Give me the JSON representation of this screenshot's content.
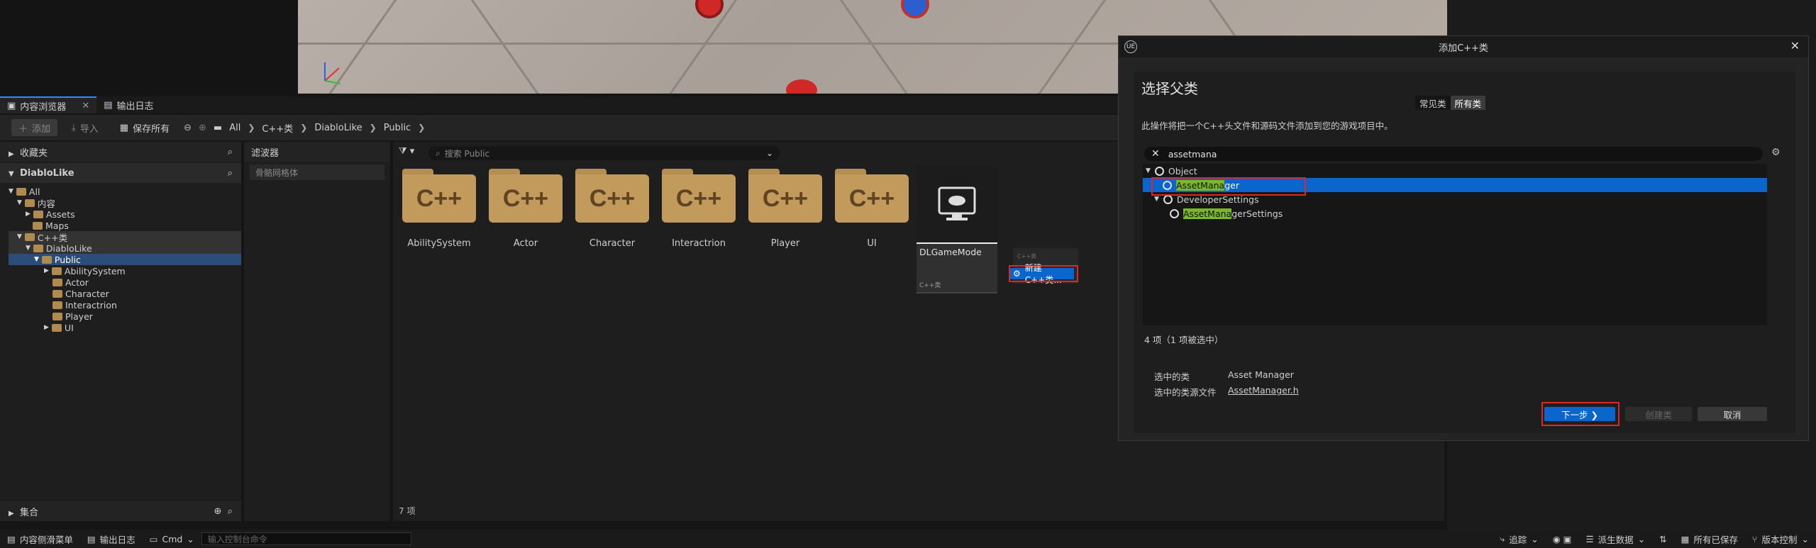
{
  "tabs": {
    "content_browser": "内容浏览器",
    "output_log": "输出日志"
  },
  "toolbar": {
    "add": "添加",
    "import": "导入",
    "save_all": "保存所有",
    "breadcrumbs": [
      "All",
      "C++类",
      "DiabloLike",
      "Public"
    ]
  },
  "sidebar": {
    "favorites": "收藏夹",
    "project": "DiabloLike",
    "tree": [
      {
        "label": "All",
        "indent": 0
      },
      {
        "label": "内容",
        "indent": 1
      },
      {
        "label": "Assets",
        "indent": 2
      },
      {
        "label": "Maps",
        "indent": 2
      },
      {
        "label": "C++类",
        "indent": 1
      },
      {
        "label": "DiabloLike",
        "indent": 2
      },
      {
        "label": "Public",
        "indent": 3
      },
      {
        "label": "AbilitySystem",
        "indent": 4
      },
      {
        "label": "Actor",
        "indent": 4
      },
      {
        "label": "Character",
        "indent": 4
      },
      {
        "label": "Interactrion",
        "indent": 4
      },
      {
        "label": "Player",
        "indent": 4
      },
      {
        "label": "UI",
        "indent": 4
      }
    ],
    "collections": "集合"
  },
  "filters": {
    "title": "滤波器",
    "item": "骨骼网格体"
  },
  "content": {
    "search_placeholder": "搜索 Public",
    "folders": [
      "AbilitySystem",
      "Actor",
      "Character",
      "Interactrion",
      "Player",
      "UI"
    ],
    "folder_glyph": "C++",
    "class_card": {
      "name": "DLGameMode",
      "tag": "C++类"
    },
    "ghost_tag": "C++类",
    "new_cpp_class": "新建C++类...",
    "item_count": "7 项"
  },
  "statusbar": {
    "drawer": "内容侧滑菜单",
    "output_log": "输出日志",
    "cmd": "Cmd",
    "cmd_placeholder": "输入控制台命令",
    "trace": "追踪",
    "derived_data": "派生数据",
    "all_saved": "所有已保存",
    "source_control": "版本控制"
  },
  "dialog": {
    "title": "添加C++类",
    "logo": "UE",
    "heading": "选择父类",
    "seg_common": "常见类",
    "seg_all": "所有类",
    "description": "此操作将把一个C++头文件和源码文件添加到您的游戏项目中。",
    "search_value": "assetmana",
    "tree": {
      "root": "Object",
      "asset_manager_match": "AssetMana",
      "asset_manager_rest": "ger",
      "developer_settings": "DeveloperSettings",
      "settings_match": "AssetMana",
      "settings_rest": "gerSettings"
    },
    "status": "4 项（1 项被选中）",
    "selected_class_label": "选中的类",
    "selected_class_value": "Asset Manager",
    "selected_file_label": "选中的类源文件",
    "selected_file_value": "AssetManager.h",
    "next": "下一步 ❯",
    "create": "创建类",
    "cancel": "取消"
  },
  "colors": {
    "accent": "#0a66cc",
    "highlight_red": "#e02525",
    "match_green": "#7ab82a",
    "folder": "#c19a5c"
  }
}
